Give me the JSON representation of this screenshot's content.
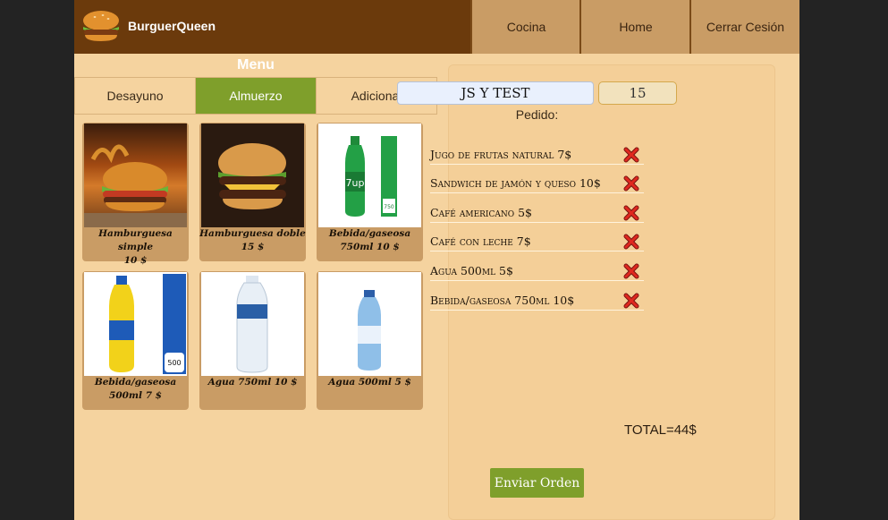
{
  "header": {
    "brand": "BurguerQueen",
    "nav": [
      "Cocina",
      "Home",
      "Cerrar Cesión"
    ]
  },
  "menu": {
    "title": "Menu",
    "tabs": [
      "Desayuno",
      "Almuerzo",
      "Adicional"
    ],
    "active_tab": "Almuerzo",
    "products": [
      {
        "line1": "Hamburguesa simple",
        "line2": "10 $",
        "image": "burger-icon"
      },
      {
        "line1": "Hamburguesa doble",
        "line2": "15 $",
        "image": "burger-icon"
      },
      {
        "line1": "Bebida/gaseosa",
        "line2": "750ml 10 $",
        "image": "green-soda-bottle-icon"
      },
      {
        "line1": "Bebida/gaseosa",
        "line2": "500ml 7 $",
        "image": "yellow-soda-bottle-icon"
      },
      {
        "line1": "Agua 750ml 10 $",
        "line2": "",
        "image": "water-bottle-icon"
      },
      {
        "line1": "Agua 500ml 5 $",
        "line2": "",
        "image": "water-bottle-icon"
      }
    ]
  },
  "order": {
    "client_name": "JS Y TEST",
    "table_number": "15",
    "pedido_label": "Pedido:",
    "items": [
      "Jugo de frutas natural 7$",
      "Sandwich de jamón y queso 10$",
      "Café americano 5$",
      "Café con leche 7$",
      "Agua 500ml 5$",
      "Bebida/gaseosa 750ml 10$"
    ],
    "total": "TOTAL=44$",
    "send_label": "Enviar Orden"
  },
  "colors": {
    "header": "#6b3a0c",
    "nav_button": "#c99c65",
    "background": "#f5d39f",
    "accent_green": "#7f9f2b",
    "delete_red": "#d9251d"
  }
}
